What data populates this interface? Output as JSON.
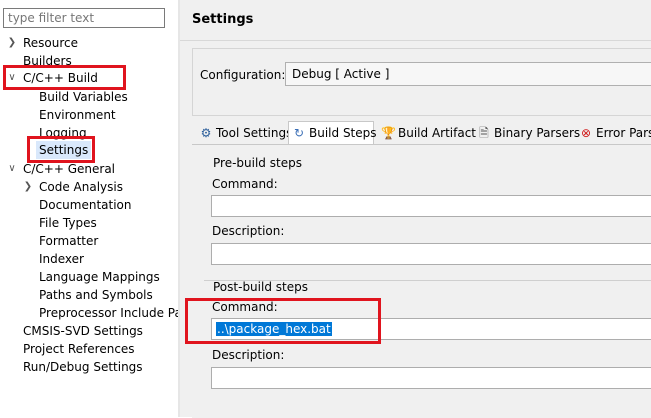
{
  "filter": {
    "placeholder": "type filter text"
  },
  "tree": {
    "items": [
      {
        "label": "Resource"
      },
      {
        "label": "Builders"
      },
      {
        "label": "C/C++ Build"
      },
      {
        "label": "Build Variables"
      },
      {
        "label": "Environment"
      },
      {
        "label": "Logging"
      },
      {
        "label": "Settings"
      },
      {
        "label": "C/C++ General"
      },
      {
        "label": "Code Analysis"
      },
      {
        "label": "Documentation"
      },
      {
        "label": "File Types"
      },
      {
        "label": "Formatter"
      },
      {
        "label": "Indexer"
      },
      {
        "label": "Language Mappings"
      },
      {
        "label": "Paths and Symbols"
      },
      {
        "label": "Preprocessor Include Pat"
      },
      {
        "label": "CMSIS-SVD Settings"
      },
      {
        "label": "Project References"
      },
      {
        "label": "Run/Debug Settings"
      }
    ]
  },
  "page": {
    "title": "Settings"
  },
  "configuration": {
    "label": "Configuration:",
    "value": "Debug  [ Active ]"
  },
  "tabs": [
    {
      "label": "Tool Settings",
      "icon": "tool-settings-icon"
    },
    {
      "label": "Build Steps",
      "icon": "build-steps-icon"
    },
    {
      "label": "Build Artifact",
      "icon": "build-artifact-icon"
    },
    {
      "label": "Binary Parsers",
      "icon": "binary-parsers-icon"
    },
    {
      "label": "Error Parse",
      "icon": "error-parsers-icon"
    }
  ],
  "pre_build": {
    "title": "Pre-build steps",
    "command_label": "Command:",
    "command_value": "",
    "description_label": "Description:",
    "description_value": ""
  },
  "post_build": {
    "title": "Post-build steps",
    "command_label": "Command:",
    "command_value": "..\\package_hex.bat",
    "description_label": "Description:",
    "description_value": ""
  },
  "colors": {
    "highlight": "#e0141e",
    "selection": "#0078d7"
  }
}
